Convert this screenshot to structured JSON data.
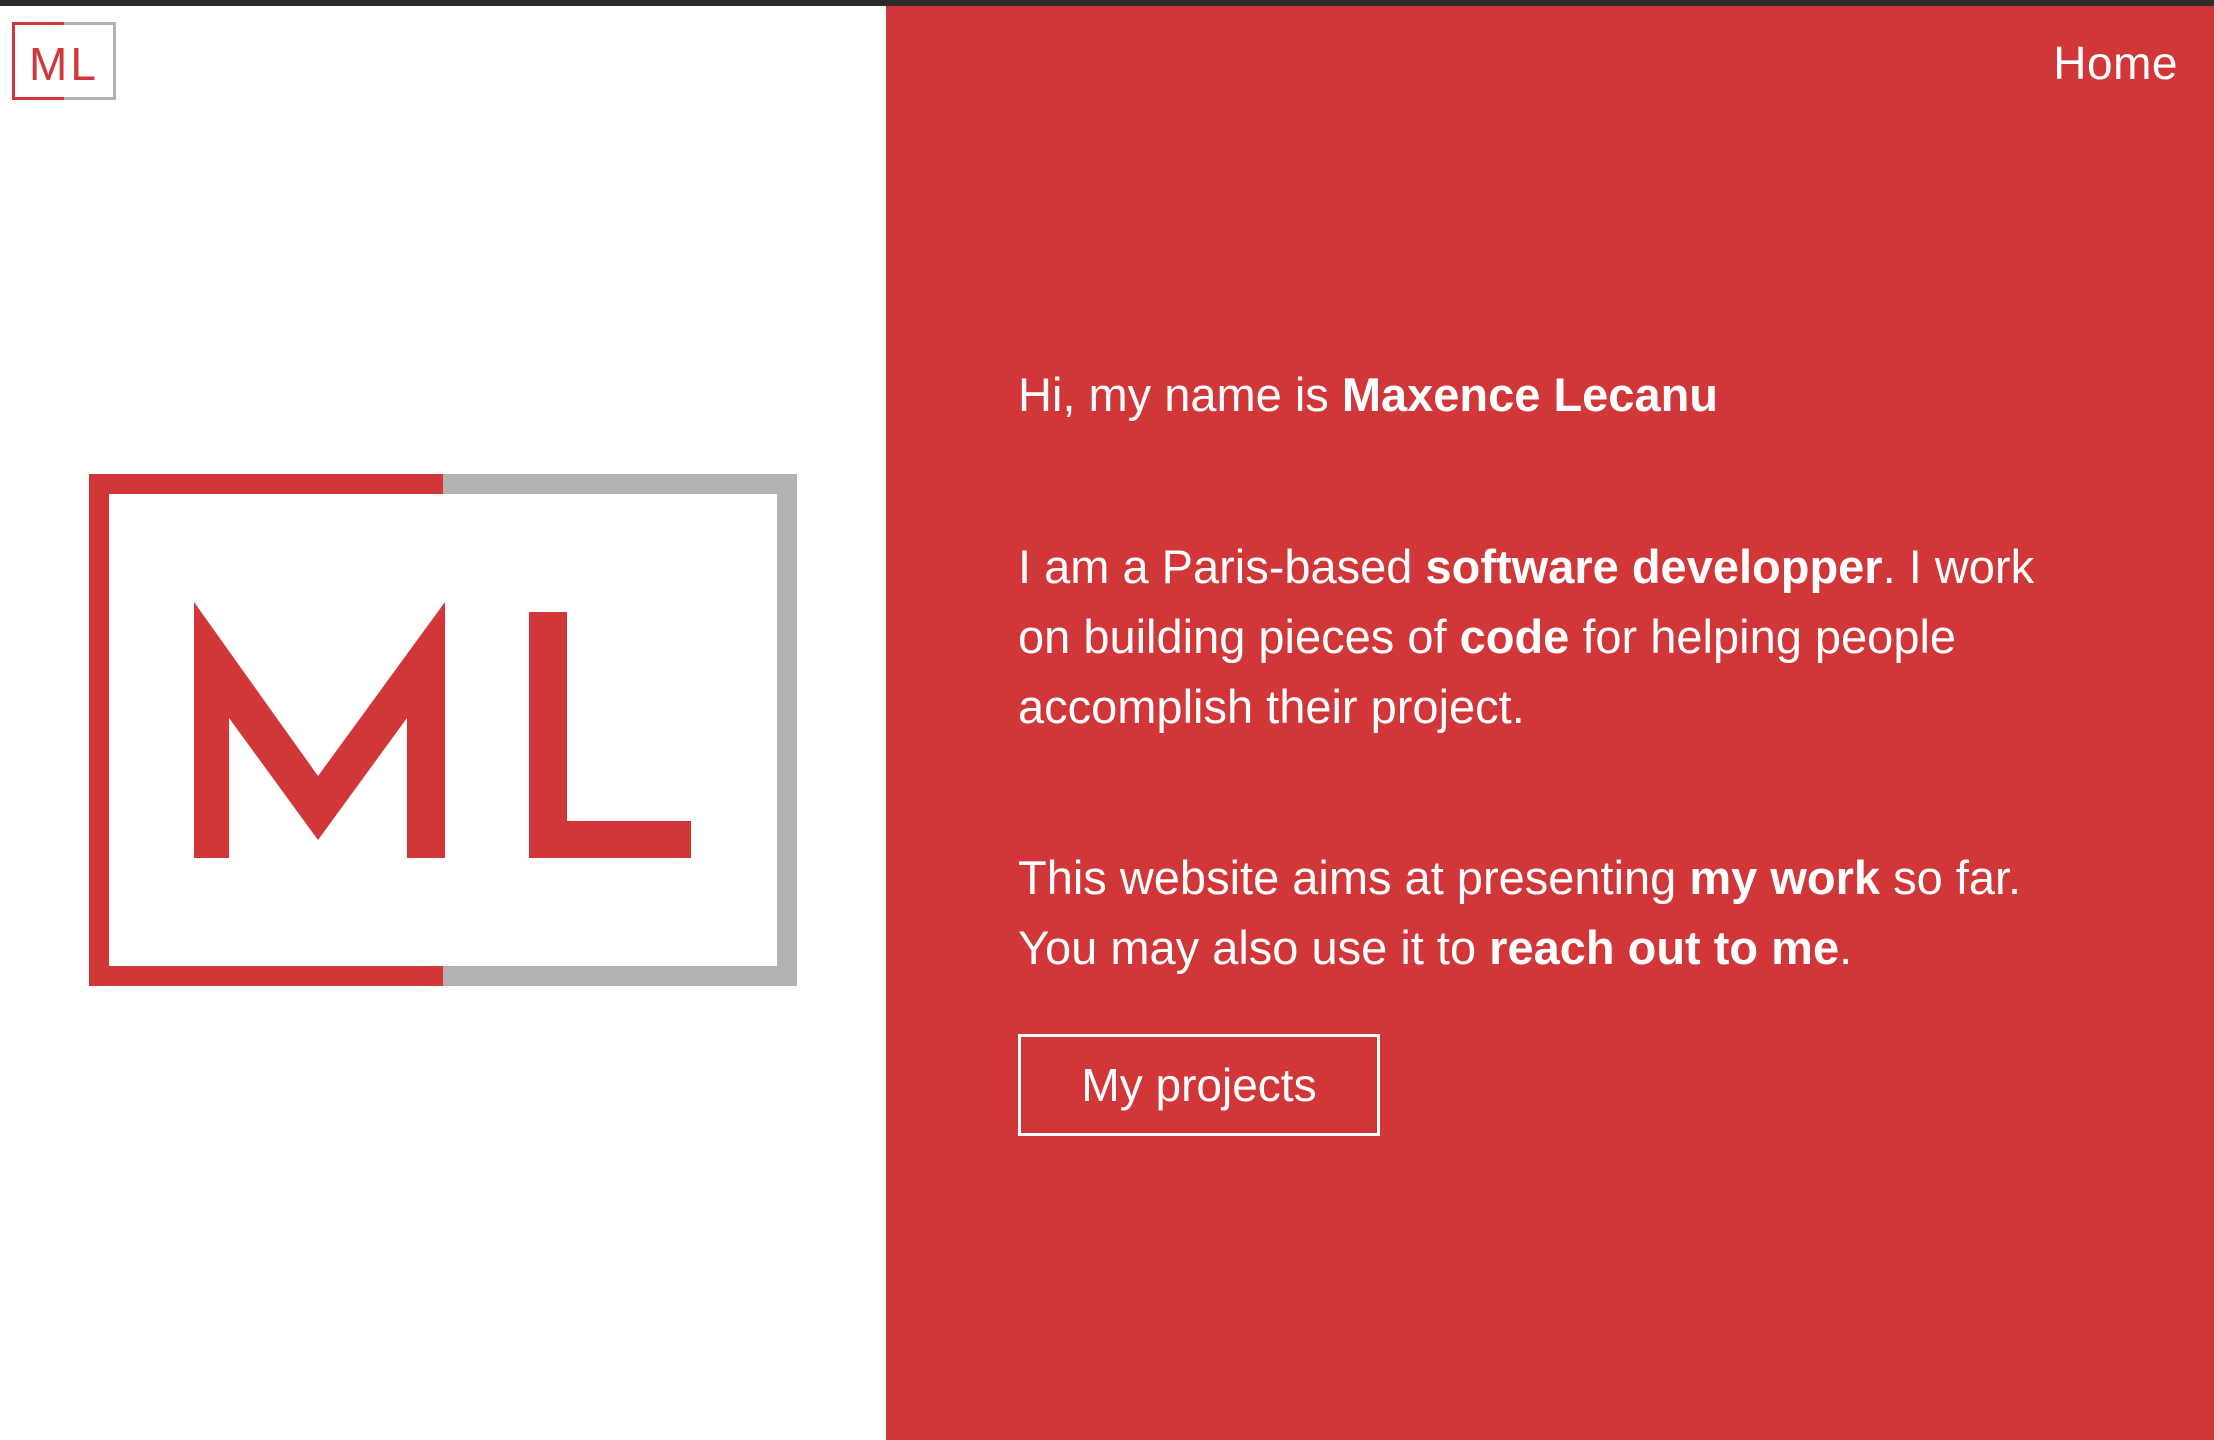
{
  "logo": {
    "small_text": "ML",
    "large_text": "ML"
  },
  "nav": {
    "home_label": "Home"
  },
  "intro": {
    "p1_prefix": "Hi, my name is ",
    "p1_name": "Maxence Lecanu",
    "p2_prefix": "I am a Paris-based ",
    "p2_role": "software developper",
    "p2_middle": ". I work on building pieces of ",
    "p2_code": "code",
    "p2_suffix": " for helping people accomplish their project.",
    "p3_prefix": "This website aims at presenting ",
    "p3_work": "my work",
    "p3_middle": " so far. You may also use it to ",
    "p3_reach": "reach out to me",
    "p3_suffix": "."
  },
  "cta": {
    "projects_label": "My projects"
  },
  "colors": {
    "accent_red": "#d13638",
    "logo_gray": "#b3b3b3",
    "left_bg": "#ffffff"
  }
}
